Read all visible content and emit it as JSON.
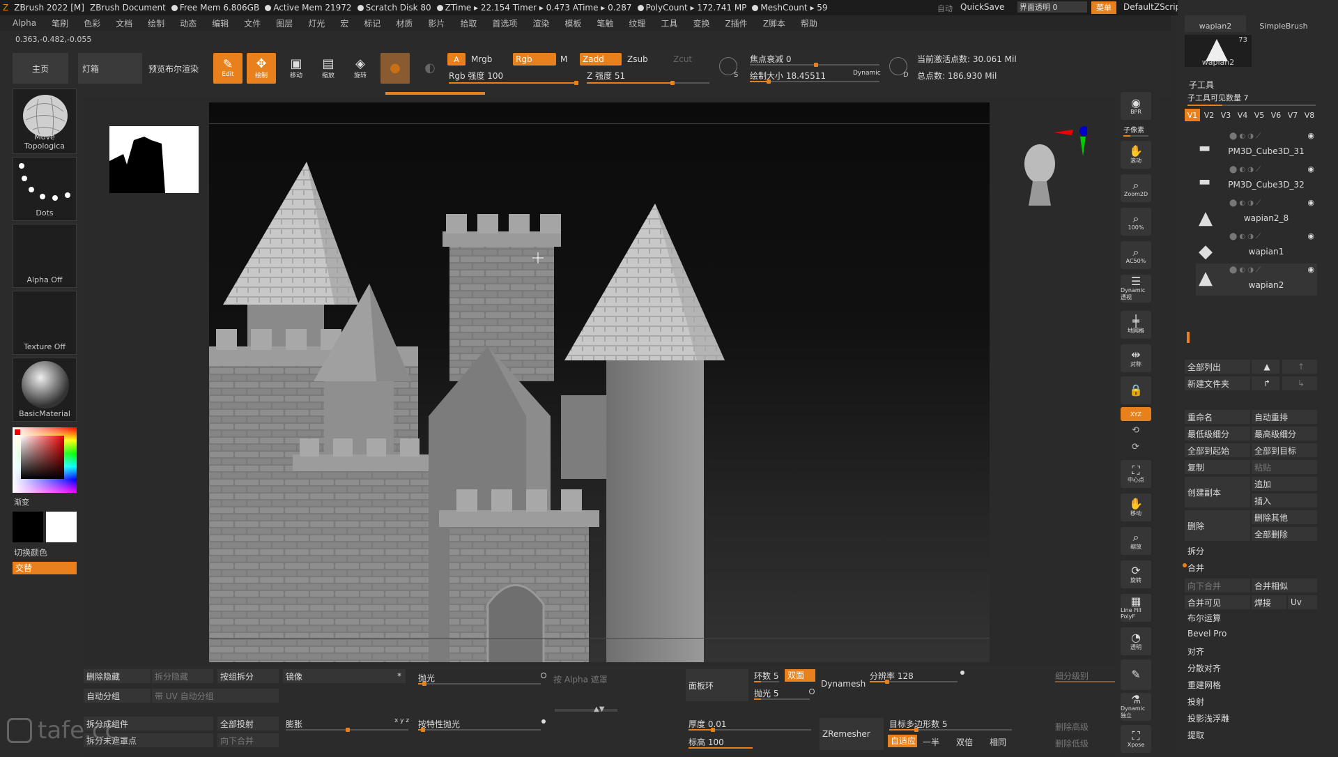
{
  "titlebar": {
    "app": "ZBrush 2022 [M]",
    "document": "ZBrush Document",
    "free_mem": "Free Mem 6.806GB",
    "active_mem": "Active Mem 21972",
    "scratch_disk": "Scratch Disk 80",
    "ztime": "ZTime ▸ 22.154 Timer ▸ 0.473 ATime ▸ 0.287",
    "polycount": "PolyCount ▸ 172.741 MP",
    "meshcount": "MeshCount ▸ 59",
    "auto": "自动",
    "quicksave": "QuickSave",
    "ui_transparency": "界面透明 0",
    "menu": "菜单",
    "default_zscript": "DefaultZScript"
  },
  "menubar": [
    "Alpha",
    "笔刷",
    "色彩",
    "文档",
    "绘制",
    "动态",
    "编辑",
    "文件",
    "图层",
    "灯光",
    "宏",
    "标记",
    "材质",
    "影片",
    "拾取",
    "首选项",
    "渲染",
    "模板",
    "笔触",
    "纹理",
    "工具",
    "变换",
    "Z插件",
    "Z脚本",
    "帮助"
  ],
  "coords": "0.363,-0.482,-0.055",
  "toolbar": {
    "home": "主页",
    "lightbox": "灯箱",
    "preview_bool": "预览布尔渲染",
    "edit": "Edit",
    "draw": "绘制",
    "move": "移动",
    "scale": "缩放",
    "rotate": "旋转",
    "a_label": "A",
    "mrgb": "Mrgb",
    "rgb": "Rgb",
    "m": "M",
    "rgb_intensity": "Rgb 强度 100",
    "zadd": "Zadd",
    "zsub": "Zsub",
    "zcut": "Zcut",
    "z_intensity": "Z 强度 51",
    "focal_shift": "焦点衰减 0",
    "draw_size": "绘制大小 18.45511",
    "dynamic": "Dynamic",
    "active_points": "当前激活点数: 30.061 Mil",
    "total_points": "总点数: 186.930 Mil"
  },
  "left": {
    "brush": "Move Topologica",
    "stroke": "Dots",
    "alpha": "Alpha Off",
    "texture": "Texture Off",
    "material": "BasicMaterial",
    "gradient": "渐变",
    "switch_color": "切换颜色",
    "alternate": "交替"
  },
  "rightstrip": [
    "BPR",
    "子像素",
    "滚动",
    "Zoom2D",
    "100%",
    "AC50%",
    "Dynamic 透视",
    "地网格",
    "对称",
    "",
    "XYZ",
    "",
    "",
    "中心点",
    "移动",
    "缩放",
    "旋转",
    "Line Fill PolyF",
    "透明",
    "Dynamic 独立",
    "Xpose"
  ],
  "rightpanel": {
    "top_thumb1": "wapian2",
    "top_thumb2": "SimpleBrush",
    "top_thumb3": "wapian2",
    "top_thumb3_count": "73",
    "subtool_title": "子工具",
    "visible_count": "子工具可见数量 7",
    "versions": [
      "V1",
      "V2",
      "V3",
      "V4",
      "V5",
      "V6",
      "V7",
      "V8"
    ],
    "subtools": [
      "PM3D_Cube3D_31",
      "PM3D_Cube3D_32",
      "wapian2_8",
      "wapian1",
      "wapian2"
    ],
    "list_all": "全部列出",
    "new_folder": "新建文件夹",
    "rename": "重命名",
    "auto_reorder": "自动重排",
    "lowest_subdiv": "最低级细分",
    "highest_subdiv": "最高级细分",
    "all_to_start": "全部到起始",
    "all_to_target": "全部到目标",
    "copy": "复制",
    "paste": "粘贴",
    "create_copy": "创建副本",
    "append": "追加",
    "insert": "插入",
    "delete": "删除",
    "delete_others": "删除其他",
    "delete_all": "全部删除",
    "split": "拆分",
    "merge": "合并",
    "merge_down": "向下合并",
    "merge_similar": "合并相似",
    "merge_visible": "合并可见",
    "weld": "焊接",
    "uv": "Uv",
    "boolean": "布尔运算",
    "bevel_pro": "Bevel Pro",
    "align": "对齐",
    "distribute": "分散对齐",
    "remesh": "重建网格",
    "project": "投射",
    "shallow_project": "投影浅浮雕",
    "extract": "提取"
  },
  "bottom": {
    "delete_hidden": "删除隐藏",
    "split_hidden": "拆分隐藏",
    "groups_split": "按组拆分",
    "mirror": "镜像",
    "polish": "抛光",
    "alpha_mask": "按 Alpha 遮罩",
    "panel_loops": "面板环",
    "loops": "环数 5",
    "double": "双面",
    "polish2": "抛光 5",
    "dynamesh": "Dynamesh",
    "resolution": "分辨率 128",
    "subdiv_level": "细分级别",
    "auto_groups": "自动分组",
    "uv_groups": "带 UV 自动分组",
    "split_to_parts": "拆分成组件",
    "project_all": "全部投射",
    "inflate": "膨胀",
    "feature_polish": "按特性抛光",
    "thickness": "厚度 0.01",
    "zremesher": "ZRemesher",
    "target_polys": "目标多边形数 5",
    "delete_higher": "删除高级",
    "split_unmasked": "拆分未遮罩点",
    "merge_down2": "向下合并",
    "elevation": "标高 100",
    "adaptive": "自适应",
    "half": "一半",
    "same": "双倍",
    "same2": "相同",
    "delete_lower": "删除低级",
    "watermark": "tafe.cc"
  },
  "colors": {
    "accent": "#e8801c",
    "bg": "#2b2b2b"
  }
}
